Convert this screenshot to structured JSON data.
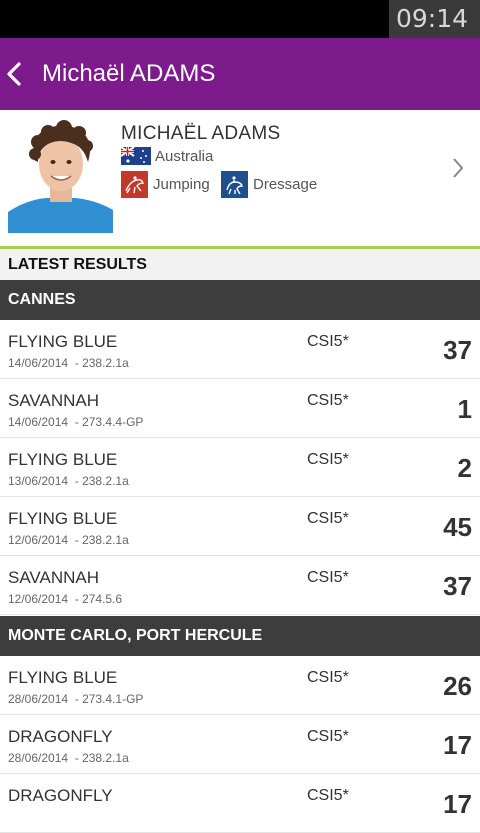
{
  "status_bar": {
    "time": "09:14"
  },
  "app_bar": {
    "title": "Michaël ADAMS"
  },
  "profile": {
    "name": "MICHAËL ADAMS",
    "country": "Australia",
    "disciplines": [
      "Jumping",
      "Dressage"
    ]
  },
  "section_title": "LATEST RESULTS",
  "groups": [
    {
      "name": "CANNES",
      "rows": [
        {
          "horse": "FLYING BLUE",
          "date": "14/06/2014",
          "event": "238.2.1a",
          "class": "CSI5*",
          "rank": "37"
        },
        {
          "horse": "SAVANNAH",
          "date": "14/06/2014",
          "event": "273.4.4-GP",
          "class": "CSI5*",
          "rank": "1"
        },
        {
          "horse": "FLYING BLUE",
          "date": "13/06/2014",
          "event": "238.2.1a",
          "class": "CSI5*",
          "rank": "2"
        },
        {
          "horse": "FLYING BLUE",
          "date": "12/06/2014",
          "event": "238.2.1a",
          "class": "CSI5*",
          "rank": "45"
        },
        {
          "horse": "SAVANNAH",
          "date": "12/06/2014",
          "event": "274.5.6",
          "class": "CSI5*",
          "rank": "37"
        }
      ]
    },
    {
      "name": "MONTE CARLO, PORT HERCULE",
      "rows": [
        {
          "horse": "FLYING BLUE",
          "date": "28/06/2014",
          "event": "273.4.1-GP",
          "class": "CSI5*",
          "rank": "26"
        },
        {
          "horse": "DRAGONFLY",
          "date": "28/06/2014",
          "event": "238.2.1a",
          "class": "CSI5*",
          "rank": "17"
        },
        {
          "horse": "DRAGONFLY",
          "date": "",
          "event": "",
          "class": "CSI5*",
          "rank": "17"
        }
      ]
    }
  ],
  "colors": {
    "app_bar": "#7d1a8c",
    "group_header": "#3d3d3d",
    "accent_line": "#a6cf4f",
    "discipline_jumping": "#c0392b",
    "discipline_dressage": "#1f4f8f"
  },
  "icons": [
    "back-arrow-icon",
    "australia-flag-icon",
    "jumping-icon",
    "dressage-icon",
    "chevron-right-icon"
  ]
}
